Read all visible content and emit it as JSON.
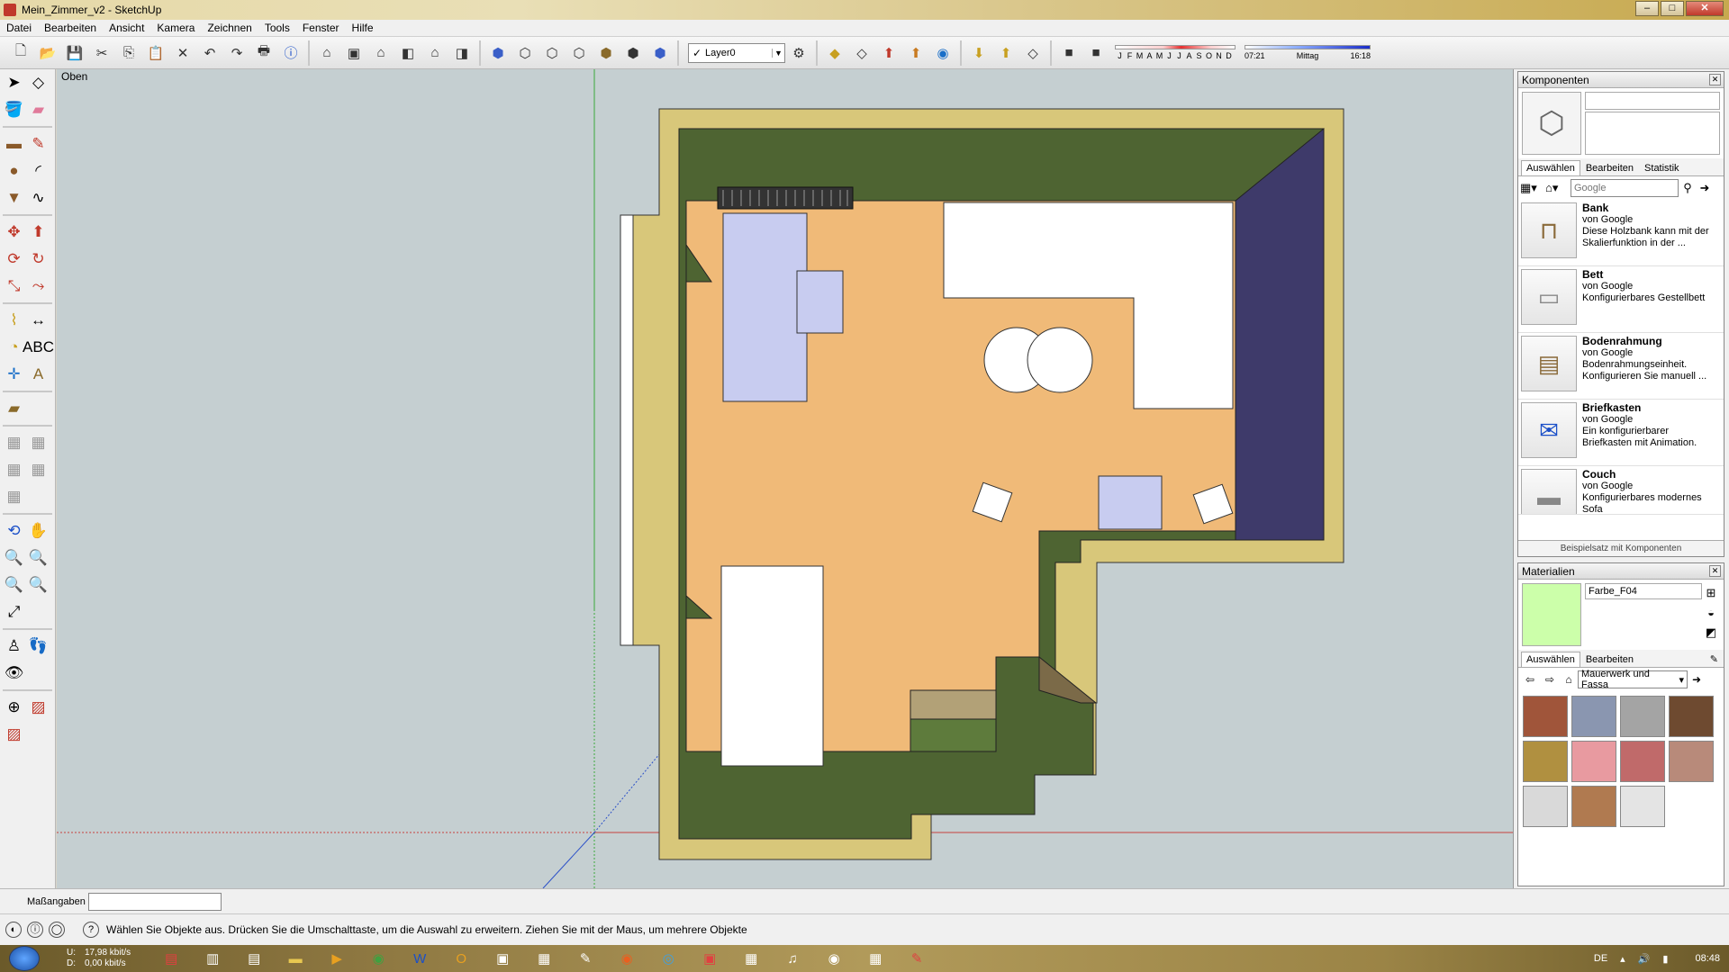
{
  "window": {
    "title": "Mein_Zimmer_v2 - SketchUp"
  },
  "menu": [
    "Datei",
    "Bearbeiten",
    "Ansicht",
    "Kamera",
    "Zeichnen",
    "Tools",
    "Fenster",
    "Hilfe"
  ],
  "toolbar": {
    "layer": "Layer0",
    "months": [
      "J",
      "F",
      "M",
      "A",
      "M",
      "J",
      "J",
      "A",
      "S",
      "O",
      "N",
      "D"
    ],
    "time_start": "07:21",
    "time_mid": "Mittag",
    "time_end": "16:18"
  },
  "viewport": {
    "label": "Oben"
  },
  "components": {
    "title": "Komponenten",
    "tabs": [
      "Auswählen",
      "Bearbeiten",
      "Statistik"
    ],
    "search_placeholder": "Google",
    "items": [
      {
        "name": "Bank",
        "by": "von Google",
        "desc": "Diese Holzbank kann mit der Skalierfunktion in der ..."
      },
      {
        "name": "Bett",
        "by": "von Google",
        "desc": "Konfigurierbares Gestellbett"
      },
      {
        "name": "Bodenrahmung",
        "by": "von Google",
        "desc": "Bodenrahmungseinheit. Konfigurieren Sie manuell ..."
      },
      {
        "name": "Briefkasten",
        "by": "von Google",
        "desc": "Ein konfigurierbarer Briefkasten mit Animation."
      },
      {
        "name": "Couch",
        "by": "von Google",
        "desc": "Konfigurierbares modernes Sofa"
      }
    ],
    "footer": "Beispielsatz mit Komponenten"
  },
  "materials": {
    "title": "Materialien",
    "current_name": "Farbe_F04",
    "current_color": "#ccffaa",
    "tabs": [
      "Auswählen",
      "Bearbeiten"
    ],
    "library": "Mauerwerk und Fassa",
    "swatches": [
      "#a0553a",
      "#8a96b0",
      "#a4a4a4",
      "#6e4a30",
      "#b09040",
      "#e89aa0",
      "#c06a6a",
      "#b88a7a",
      "#d9d9d9",
      "#b07a50",
      "#e4e4e4"
    ]
  },
  "measure": {
    "label": "Maßangaben"
  },
  "status": {
    "text": "Wählen Sie Objekte aus. Drücken Sie die Umschalttaste, um die Auswahl zu erweitern. Ziehen Sie mit der Maus, um mehrere Objekte"
  },
  "taskbar": {
    "up_label": "U:",
    "down_label": "D:",
    "up_rate": "17,98 kbit/s",
    "down_rate": "0,00 kbit/s",
    "lang": "DE",
    "clock": "08:48"
  }
}
